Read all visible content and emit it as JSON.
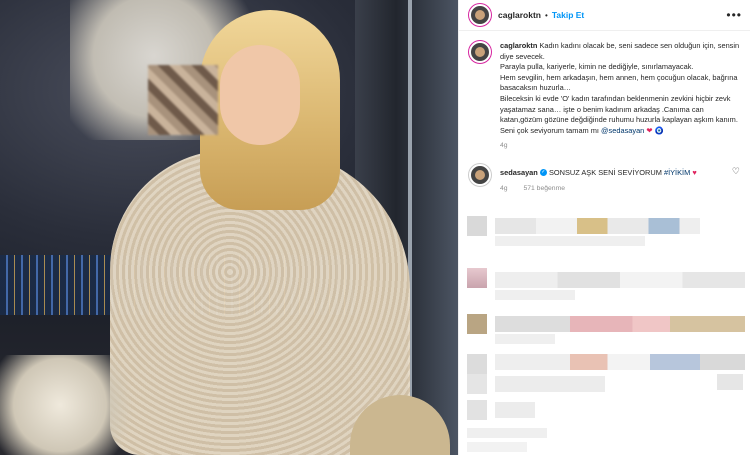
{
  "header": {
    "username": "caglaroktn",
    "separator": "•",
    "follow_label": "Takip Et",
    "more_label": "•••"
  },
  "caption": {
    "username": "caglaroktn",
    "lines": [
      "Kadın kadını olacak be, seni sadece sen olduğun için, sensin diye sevecek.",
      "Parayla pulla, kariyerle, kimin ne dediğiyle, sınırlamayacak.",
      "Hem sevgilin, hem arkadaşın, hem annen, hem çocuğun olacak, bağrına basacaksın huzurla…",
      "Bileceksin ki evde 'O' kadın tarafından beklenmenin zevkini hiçbir zevk yaşatamaz sana… işte o benim kadınım arkadaş .Canıma can katan,gözüm gözüne değdiğinde ruhumu huzurla kaplayan aşkım kanım. Seni çok seviyorum tamam mı"
    ],
    "mention": "@sedasayan",
    "time": "4g"
  },
  "reply": {
    "username": "sedasayan",
    "text": "SONSUZ AŞK SENİ SEVİYORUM",
    "hashtag": "#İYİKİM",
    "time": "4g",
    "likes": "571 beğenme",
    "heart_glyph": "♥",
    "like_icon": "heart-outline-icon"
  },
  "colors": {
    "accent": "#0095f6",
    "link": "#00376b",
    "muted": "#8e8e8e",
    "heart": "#e0245e"
  }
}
